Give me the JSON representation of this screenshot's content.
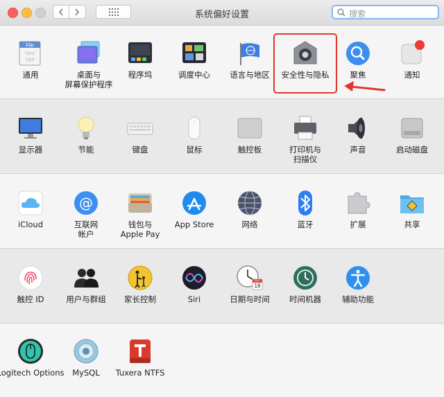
{
  "window": {
    "title": "系统偏好设置"
  },
  "search": {
    "placeholder": "搜索"
  },
  "row1": [
    {
      "label": "通用",
      "icon": "general-icon"
    },
    {
      "label": "桌面与\n屏幕保护程序",
      "icon": "desktop-screensaver-icon"
    },
    {
      "label": "程序坞",
      "icon": "dock-icon"
    },
    {
      "label": "调度中心",
      "icon": "mission-control-icon"
    },
    {
      "label": "语言与地区",
      "icon": "language-region-icon"
    },
    {
      "label": "安全性与隐私",
      "icon": "security-privacy-icon"
    },
    {
      "label": "聚焦",
      "icon": "spotlight-icon"
    },
    {
      "label": "通知",
      "icon": "notifications-icon"
    }
  ],
  "row2": [
    {
      "label": "显示器",
      "icon": "displays-icon"
    },
    {
      "label": "节能",
      "icon": "energy-saver-icon"
    },
    {
      "label": "键盘",
      "icon": "keyboard-icon"
    },
    {
      "label": "鼠标",
      "icon": "mouse-icon"
    },
    {
      "label": "触控板",
      "icon": "trackpad-icon"
    },
    {
      "label": "打印机与\n扫描仪",
      "icon": "printers-scanners-icon"
    },
    {
      "label": "声音",
      "icon": "sound-icon"
    },
    {
      "label": "启动磁盘",
      "icon": "startup-disk-icon"
    }
  ],
  "row3": [
    {
      "label": "iCloud",
      "icon": "icloud-icon"
    },
    {
      "label": "互联网\n帐户",
      "icon": "internet-accounts-icon"
    },
    {
      "label": "钱包与\nApple Pay",
      "icon": "wallet-applepay-icon"
    },
    {
      "label": "App Store",
      "icon": "app-store-icon"
    },
    {
      "label": "网络",
      "icon": "network-icon"
    },
    {
      "label": "蓝牙",
      "icon": "bluetooth-icon"
    },
    {
      "label": "扩展",
      "icon": "extensions-icon"
    },
    {
      "label": "共享",
      "icon": "sharing-icon"
    }
  ],
  "row4": [
    {
      "label": "触控 ID",
      "icon": "touch-id-icon"
    },
    {
      "label": "用户与群组",
      "icon": "users-groups-icon"
    },
    {
      "label": "家长控制",
      "icon": "parental-controls-icon"
    },
    {
      "label": "Siri",
      "icon": "siri-icon"
    },
    {
      "label": "日期与时间",
      "icon": "date-time-icon"
    },
    {
      "label": "时间机器",
      "icon": "time-machine-icon"
    },
    {
      "label": "辅助功能",
      "icon": "accessibility-icon"
    }
  ],
  "row5": [
    {
      "label": "Logitech Options",
      "icon": "logitech-options-icon"
    },
    {
      "label": "MySQL",
      "icon": "mysql-icon"
    },
    {
      "label": "Tuxera NTFS",
      "icon": "tuxera-ntfs-icon"
    }
  ],
  "calendar": {
    "month": "JUL",
    "day": "18"
  },
  "colors": {
    "highlight": "#e0362f",
    "accent": "#3d8ef0"
  }
}
